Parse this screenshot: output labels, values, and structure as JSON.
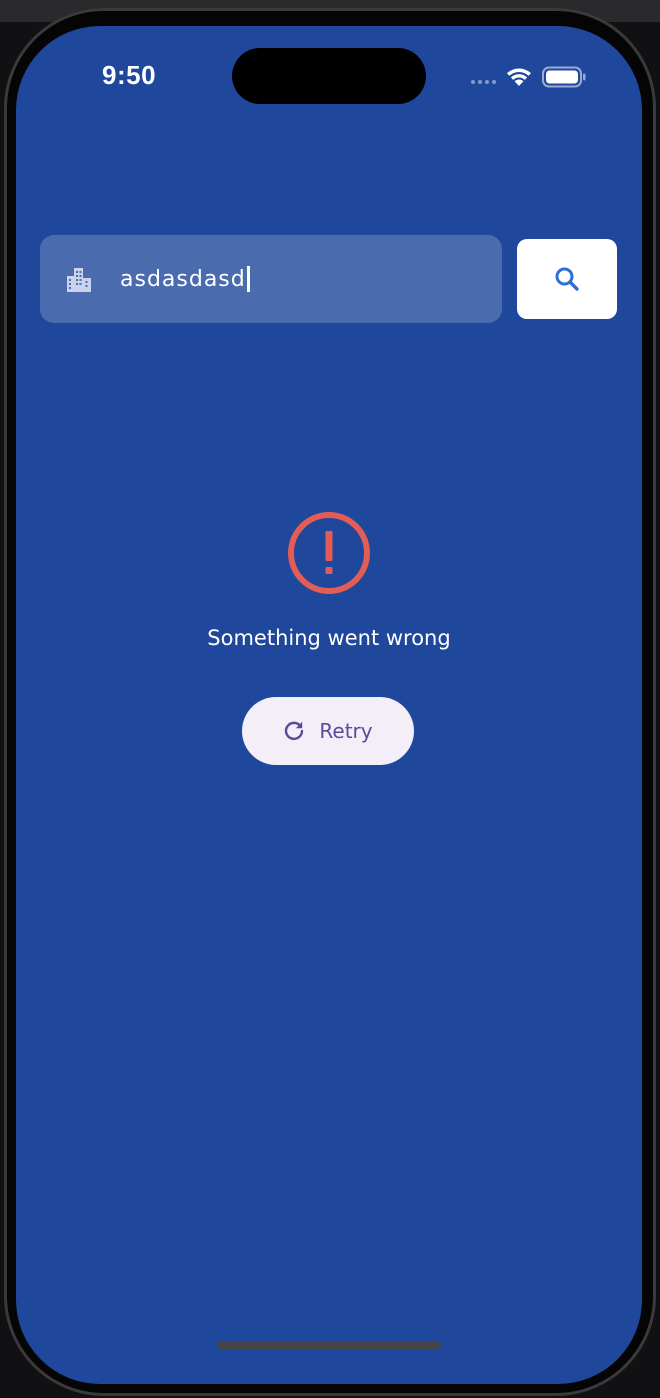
{
  "status_bar": {
    "time": "9:50"
  },
  "search": {
    "value": "asdasdasd",
    "leading_icon": "location-city-icon",
    "button_icon": "search-icon"
  },
  "error": {
    "icon": "error-outline-icon",
    "message": "Something went wrong"
  },
  "retry": {
    "label": "Retry",
    "icon": "refresh-icon"
  },
  "colors": {
    "background": "#1f479c",
    "error": "#e35d56",
    "button_surface": "#f3eef8",
    "button_text": "#5a4b97",
    "search_icon": "#2f6fd6"
  }
}
